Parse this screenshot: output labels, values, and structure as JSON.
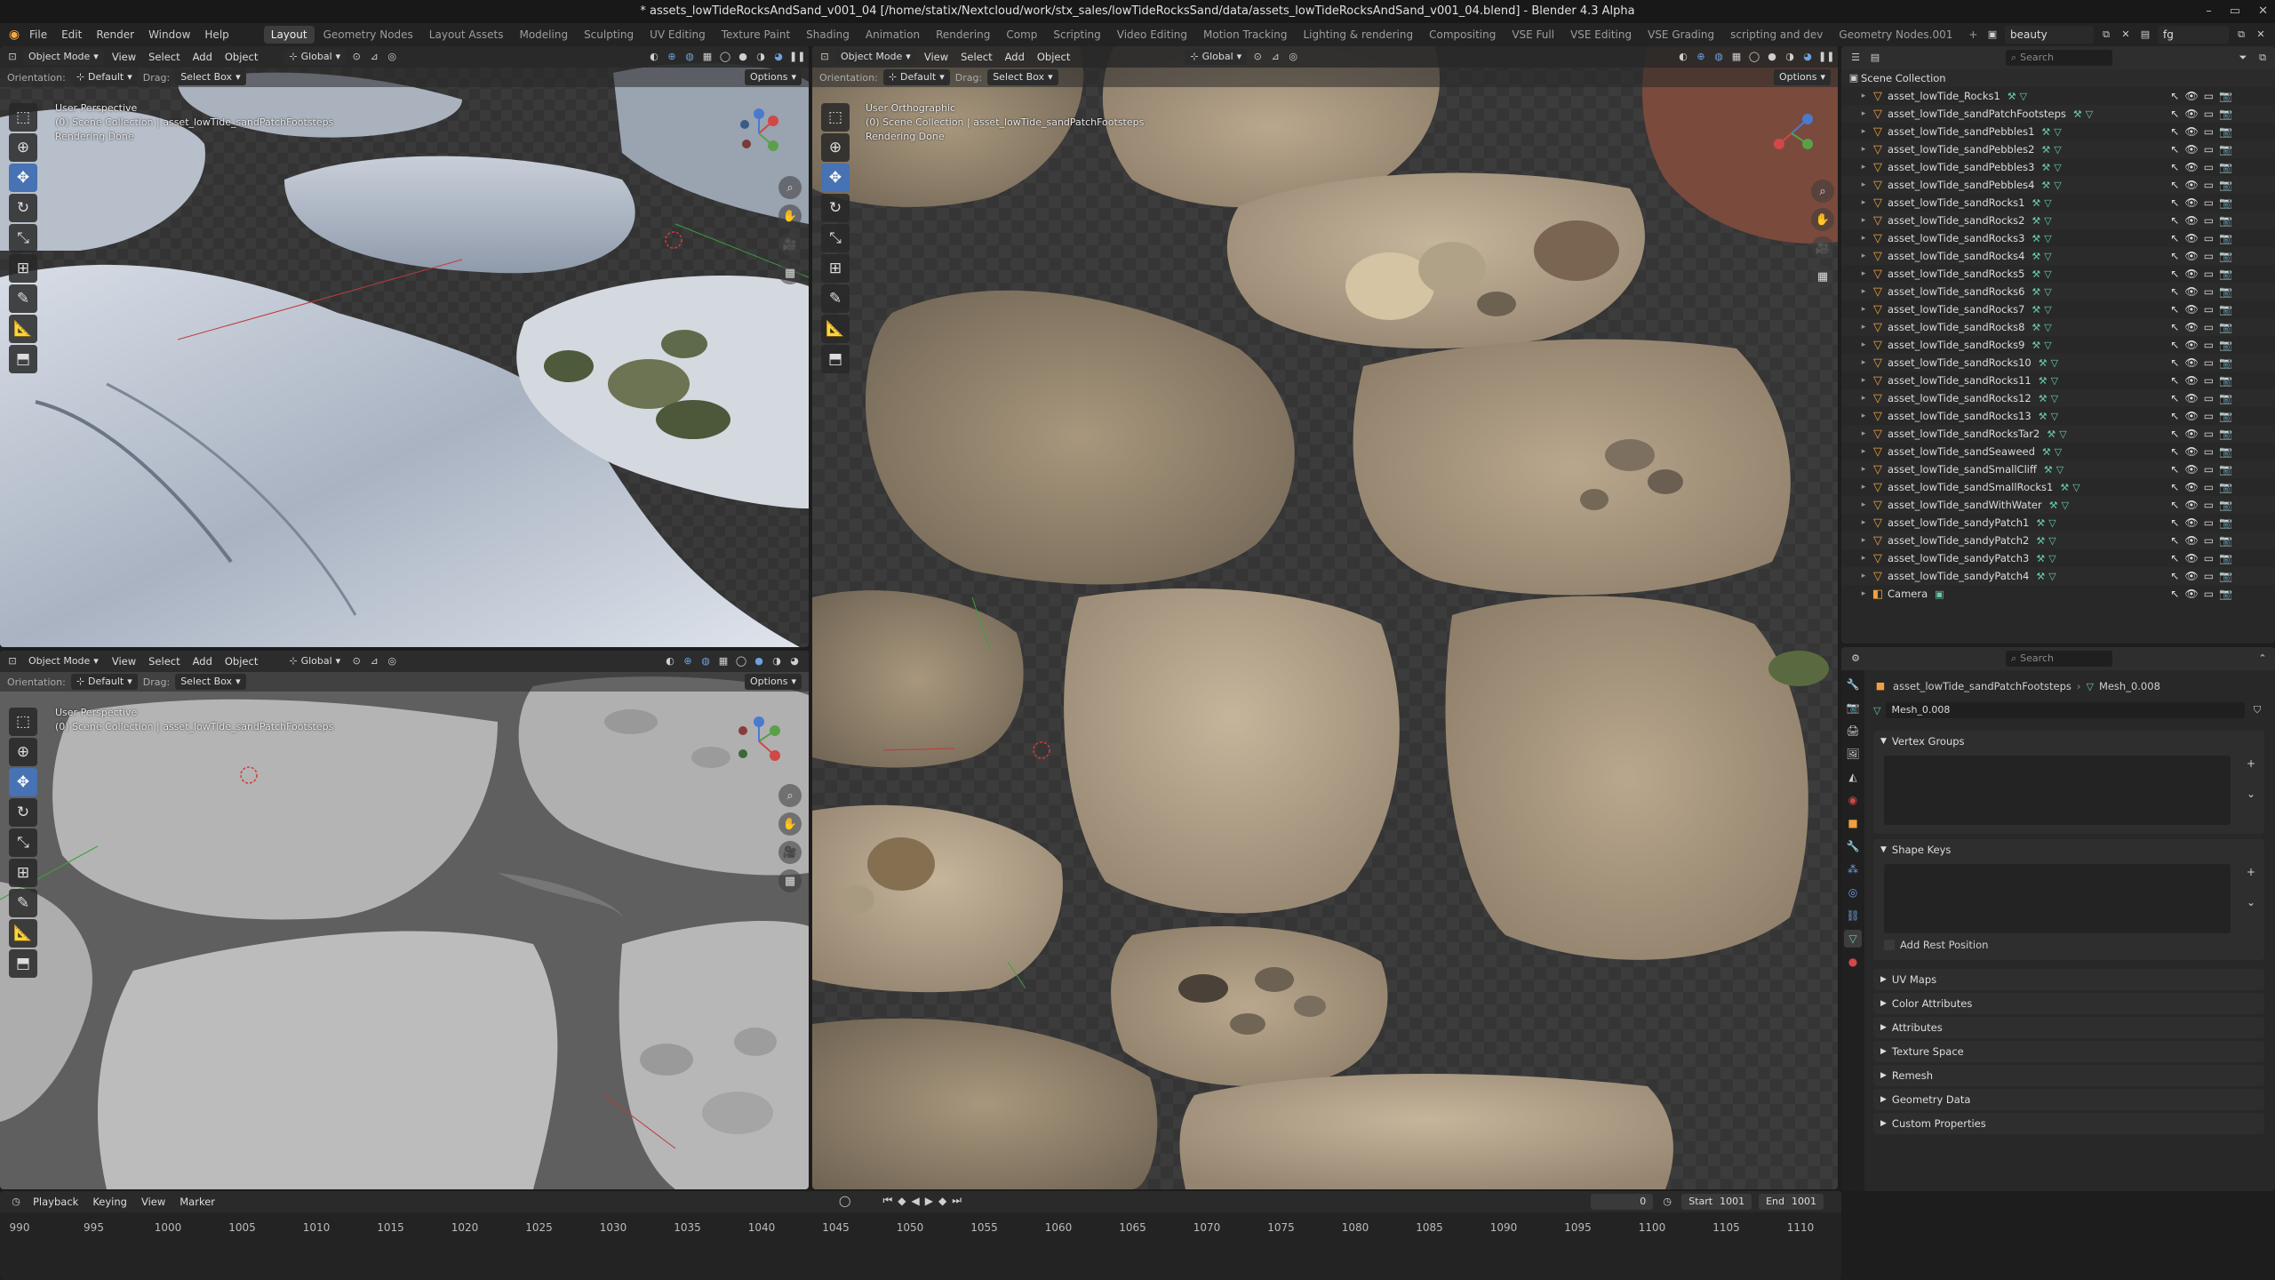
{
  "window": {
    "title": "* assets_lowTideRocksAndSand_v001_04 [/home/statix/Nextcloud/work/stx_sales/lowTideRocksSand/data/assets_lowTideRocksAndSand_v001_04.blend] - Blender 4.3 Alpha",
    "controls": [
      "–",
      "▭",
      "✕"
    ]
  },
  "menus": [
    "File",
    "Edit",
    "Render",
    "Window",
    "Help"
  ],
  "workspaces": [
    "Layout",
    "Geometry Nodes",
    "Layout Assets",
    "Modeling",
    "Sculpting",
    "UV Editing",
    "Texture Paint",
    "Shading",
    "Animation",
    "Rendering",
    "Comp",
    "Scripting",
    "Video Editing",
    "Motion Tracking",
    "Lighting & rendering",
    "Compositing",
    "VSE Full",
    "VSE Editing",
    "VSE Grading",
    "scripting and dev",
    "Geometry Nodes.001",
    "+"
  ],
  "active_workspace": "Layout",
  "scene": {
    "name": "beauty",
    "view_layer": "fg"
  },
  "viewport_header": {
    "mode": "Object Mode",
    "menus": [
      "View",
      "Select",
      "Add",
      "Object"
    ],
    "transform": "Global",
    "orientation_label": "Orientation:",
    "orientation_value": "Default",
    "drag_label": "Drag:",
    "drag_value": "Select Box",
    "options": "Options"
  },
  "viewports": [
    {
      "id": "top-left",
      "lines": [
        "User Perspective",
        "(0) Scene Collection | asset_lowTide_sandPatchFootsteps",
        "Rendering Done"
      ]
    },
    {
      "id": "bottom-left",
      "lines": [
        "User Perspective",
        "(0) Scene Collection | asset_lowTide_sandPatchFootsteps"
      ]
    },
    {
      "id": "right",
      "lines": [
        "User Orthographic",
        "(0) Scene Collection | asset_lowTide_sandPatchFootsteps",
        "Rendering Done"
      ]
    }
  ],
  "outliner": {
    "search_placeholder": "Search",
    "collection": "Scene Collection",
    "items": [
      "asset_lowTide_Rocks1",
      "asset_lowTide_sandPatchFootsteps",
      "asset_lowTide_sandPebbles1",
      "asset_lowTide_sandPebbles2",
      "asset_lowTide_sandPebbles3",
      "asset_lowTide_sandPebbles4",
      "asset_lowTide_sandRocks1",
      "asset_lowTide_sandRocks2",
      "asset_lowTide_sandRocks3",
      "asset_lowTide_sandRocks4",
      "asset_lowTide_sandRocks5",
      "asset_lowTide_sandRocks6",
      "asset_lowTide_sandRocks7",
      "asset_lowTide_sandRocks8",
      "asset_lowTide_sandRocks9",
      "asset_lowTide_sandRocks10",
      "asset_lowTide_sandRocks11",
      "asset_lowTide_sandRocks12",
      "asset_lowTide_sandRocks13",
      "asset_lowTide_sandRocksTar2",
      "asset_lowTide_sandSeaweed",
      "asset_lowTide_sandSmallCliff",
      "asset_lowTide_sandSmallRocks1",
      "asset_lowTide_sandWithWater",
      "asset_lowTide_sandyPatch1",
      "asset_lowTide_sandyPatch2",
      "asset_lowTide_sandyPatch3",
      "asset_lowTide_sandyPatch4",
      "Camera"
    ]
  },
  "properties": {
    "search_placeholder": "Search",
    "breadcrumb_object": "asset_lowTide_sandPatchFootsteps",
    "breadcrumb_mesh": "Mesh_0.008",
    "mesh_name": "Mesh_0.008",
    "vertex_groups": "Vertex Groups",
    "shape_keys": "Shape Keys",
    "add_rest_position": "Add Rest Position",
    "collapsed_panels": [
      "UV Maps",
      "Color Attributes",
      "Attributes",
      "Texture Space",
      "Remesh",
      "Geometry Data",
      "Custom Properties"
    ]
  },
  "timeline": {
    "menus": [
      "Playback",
      "Keying",
      "View",
      "Marker"
    ],
    "current_frame": "0",
    "start_label": "Start",
    "start": "1001",
    "end_label": "End",
    "end": "1001",
    "ticks": [
      "990",
      "995",
      "1000",
      "1005",
      "1010",
      "1015",
      "1020",
      "1025",
      "1030",
      "1035",
      "1040",
      "1045",
      "1050",
      "1055",
      "1060",
      "1065",
      "1070",
      "1075",
      "1080",
      "1085",
      "1090",
      "1095",
      "1100",
      "1105",
      "1110"
    ]
  }
}
